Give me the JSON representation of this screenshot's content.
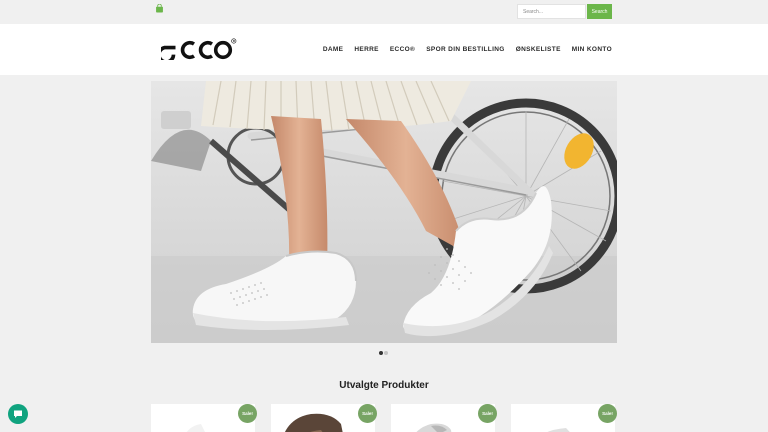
{
  "topbar": {
    "cart_icon": "shopping-bag-icon",
    "search_placeholder": "Search...",
    "search_button_label": "Search"
  },
  "header": {
    "logo_text": "ecco",
    "nav": [
      "DAME",
      "HERRE",
      "ECCO®",
      "SPOR DIN BESTILLING",
      "ØNSKELISTE",
      "MIN KONTO"
    ]
  },
  "hero": {
    "image": "woman-riding-bicycle-white-perforated-slip-on-sneakers",
    "slide_count": 2,
    "active_slide": 1
  },
  "featured": {
    "title": "Utvalgte Produkter",
    "products": [
      {
        "badge": "Sale!"
      },
      {
        "badge": "Sale!"
      },
      {
        "badge": "Sale!"
      },
      {
        "badge": "Sale!"
      }
    ]
  },
  "chat": {
    "icon": "chat-icon"
  },
  "colors": {
    "accent": "#6bb64a",
    "sale_badge": "#77a464",
    "chat": "#10a37f"
  }
}
